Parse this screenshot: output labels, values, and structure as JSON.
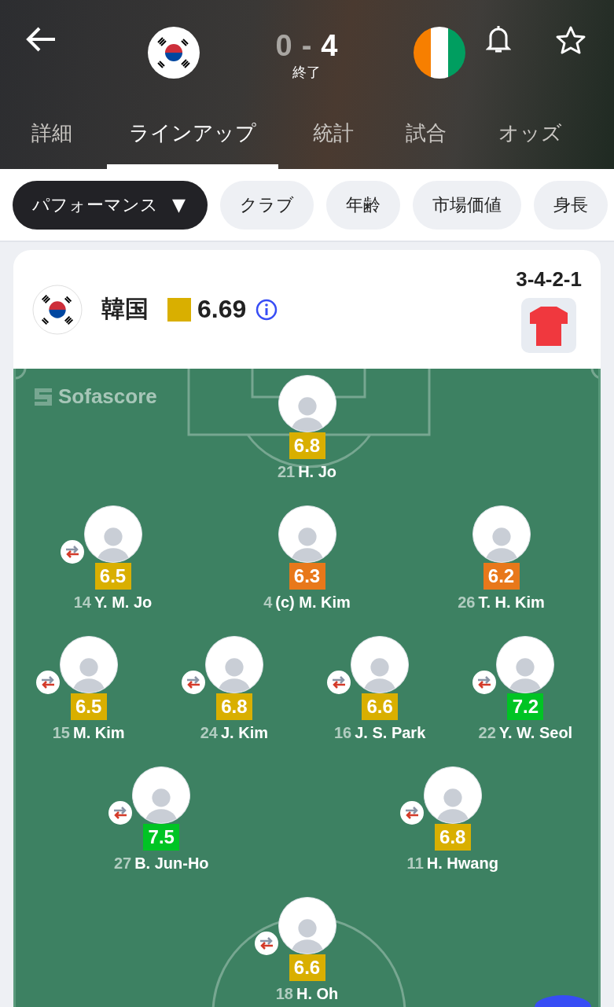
{
  "header": {
    "scores": [
      {
        "value": "0",
        "winner": false
      },
      {
        "value": "4",
        "winner": true
      }
    ],
    "separator": "-",
    "status": "終了"
  },
  "tabs": [
    {
      "label": "詳細",
      "selected": false
    },
    {
      "label": "ラインアップ",
      "selected": true
    },
    {
      "label": "統計",
      "selected": false
    },
    {
      "label": "試合",
      "selected": false
    },
    {
      "label": "オッズ",
      "selected": false
    }
  ],
  "chips": [
    {
      "label": "パフォーマンス",
      "dropdown": "▼",
      "selected": true
    },
    {
      "label": "クラブ",
      "selected": false
    },
    {
      "label": "年齢",
      "selected": false
    },
    {
      "label": "市場価値",
      "selected": false
    },
    {
      "label": "身長",
      "selected": false
    }
  ],
  "team": {
    "name": "韓国",
    "rating": "6.69",
    "formation": "3-4-2-1"
  },
  "pitch": {
    "logo": "Sofascore",
    "lines": [
      {
        "players": [
          {
            "number": "21",
            "name": "H. Jo",
            "rating": "6.8",
            "color": "#d9af00",
            "substituted": false
          }
        ]
      },
      {
        "players": [
          {
            "number": "14",
            "name": "Y. M. Jo",
            "rating": "6.5",
            "color": "#d9af00",
            "substituted": true
          },
          {
            "number": "4",
            "name": "(c) M. Kim",
            "rating": "6.3",
            "color": "#e8781a",
            "substituted": false
          },
          {
            "number": "26",
            "name": "T. H. Kim",
            "rating": "6.2",
            "color": "#e8781a",
            "substituted": false
          }
        ]
      },
      {
        "players": [
          {
            "number": "15",
            "name": "M. Kim",
            "rating": "6.5",
            "color": "#d9af00",
            "substituted": true
          },
          {
            "number": "24",
            "name": "J. Kim",
            "rating": "6.8",
            "color": "#d9af00",
            "substituted": true
          },
          {
            "number": "16",
            "name": "J. S. Park",
            "rating": "6.6",
            "color": "#d9af00",
            "substituted": true
          },
          {
            "number": "22",
            "name": "Y. W. Seol",
            "rating": "7.2",
            "color": "#00c424",
            "substituted": true
          }
        ]
      },
      {
        "players": [
          {
            "number": "27",
            "name": "B. Jun-Ho",
            "rating": "7.5",
            "color": "#00c424",
            "substituted": true
          },
          {
            "number": "11",
            "name": "H. Hwang",
            "rating": "6.8",
            "color": "#d9af00",
            "substituted": true
          }
        ]
      },
      {
        "players": [
          {
            "number": "18",
            "name": "H. Oh",
            "rating": "6.6",
            "color": "#d9af00",
            "substituted": true
          }
        ]
      }
    ]
  }
}
